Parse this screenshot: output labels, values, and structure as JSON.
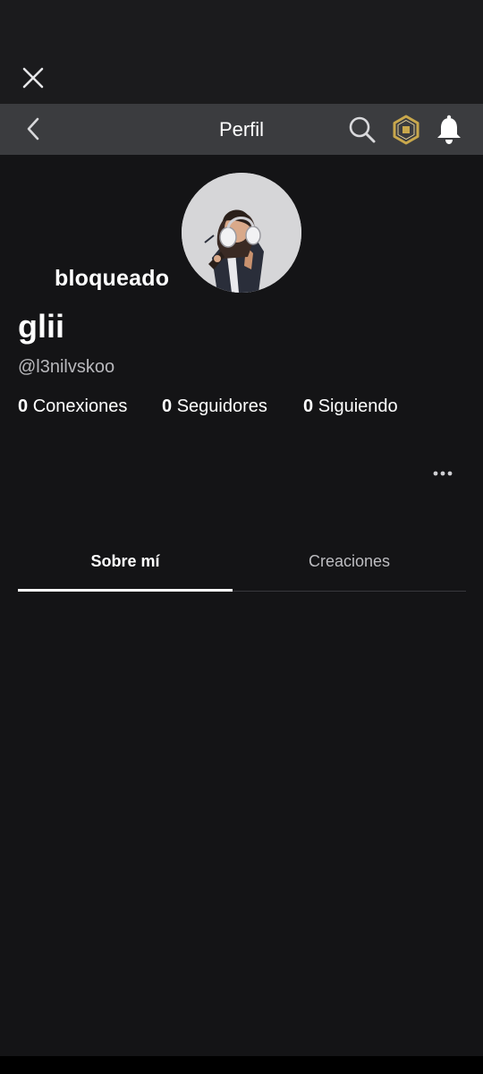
{
  "navbar": {
    "title": "Perfil"
  },
  "profile": {
    "status_label": "bloqueado",
    "display_name": "glii",
    "username": "@l3nilvskoo"
  },
  "stats": [
    {
      "value": "0",
      "label": "Conexiones"
    },
    {
      "value": "0",
      "label": "Seguidores"
    },
    {
      "value": "0",
      "label": "Siguiendo"
    }
  ],
  "tabs": [
    {
      "label": "Sobre mí",
      "active": true
    },
    {
      "label": "Creaciones",
      "active": false
    }
  ],
  "colors": {
    "background": "#141416",
    "navbar": "#3b3c3f",
    "robux_gold": "#c9a84c",
    "text_muted": "#b8b8bc"
  },
  "icons": {
    "close": "close-icon",
    "back": "chevron-left-icon",
    "search": "search-icon",
    "currency": "robux-icon",
    "notifications": "bell-icon",
    "more": "more-horizontal-icon"
  }
}
